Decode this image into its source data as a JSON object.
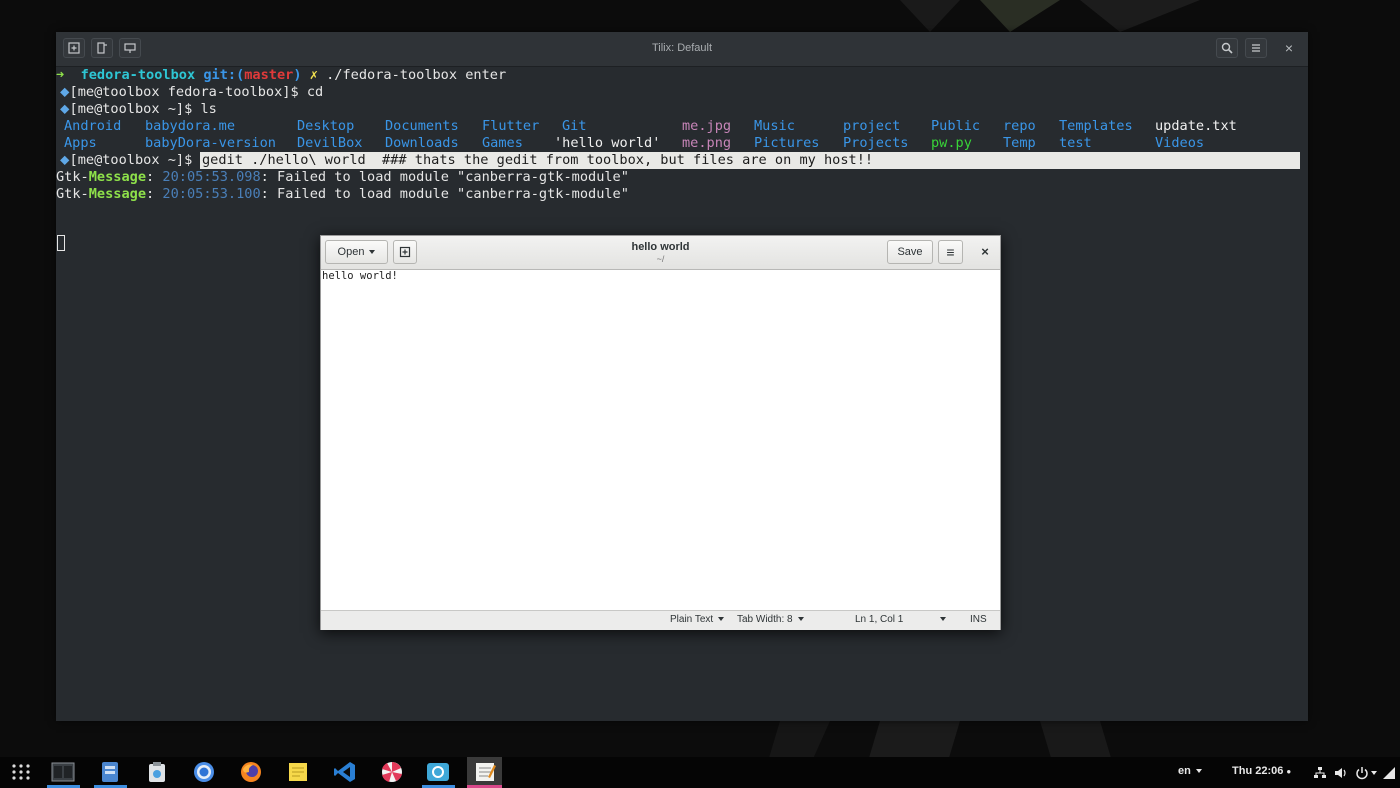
{
  "tilix": {
    "title": "Tilix: Default",
    "buttons": [
      "add-terminal-icon",
      "split-horizontal-icon",
      "split-vertical-icon",
      "search-icon",
      "menu-icon",
      "close-icon"
    ],
    "close_glyph": "×"
  },
  "terminal": {
    "line1": {
      "arrow": "➜",
      "dir": "fedora-toolbox",
      "git_label": "git:(",
      "branch": "master",
      "git_close": ")",
      "dirty": "✗",
      "cmd": "./fedora-toolbox enter"
    },
    "line2": {
      "bullet": "⬥",
      "prompt": "[me@toolbox fedora-toolbox]$",
      "cmd": "cd"
    },
    "line3": {
      "bullet": "⬥",
      "prompt": "[me@toolbox ~]$",
      "cmd": "ls"
    },
    "ls_row1": [
      "Android",
      "babydora.me",
      "Desktop",
      "Documents",
      "Flutter",
      "Git",
      "me.jpg",
      "Music",
      "project",
      "Public",
      "repo",
      "Templates",
      "update.txt"
    ],
    "ls_row2": [
      "Apps",
      "babyDora-version",
      "DevilBox",
      "Downloads",
      "Games",
      "'hello world'",
      "me.png",
      "Pictures",
      "Projects",
      "pw.py",
      "Temp",
      "test",
      "Videos"
    ],
    "line6": {
      "bullet": "⬥",
      "prompt": "[me@toolbox ~]$",
      "cmd": "gedit ./hello\\ world  ### thats the gedit from toolbox, but files are on my host!!"
    },
    "msg1": {
      "prefix": "Gtk-",
      "tag": "Message",
      "colon": ":",
      "time": "20:05:53.098",
      "text": ": Failed to load module \"canberra-gtk-module\""
    },
    "msg2": {
      "prefix": "Gtk-",
      "tag": "Message",
      "colon": ":",
      "time": "20:05:53.100",
      "text": ": Failed to load module \"canberra-gtk-module\""
    }
  },
  "gedit": {
    "open_label": "Open",
    "title": "hello world",
    "subtitle": "~/",
    "save_label": "Save",
    "menu_glyph": "≡",
    "close_glyph": "×",
    "content": "hello world!",
    "status": {
      "language": "Plain Text",
      "tab_width": "Tab Width: 8",
      "position": "Ln 1, Col 1",
      "mode": "INS"
    }
  },
  "taskbar": {
    "apps": [
      "app-grid-icon",
      "tilix-icon",
      "files-icon",
      "clipboard-icon",
      "chromium-icon",
      "firefox-icon",
      "sticky-notes-icon",
      "vscode-icon",
      "peppermint-icon",
      "mojave-icon",
      "gedit-icon"
    ],
    "lang": "en",
    "clock": "Thu 22:06",
    "clock_dot": "●"
  },
  "colors": {
    "terminal_bg": "#272b2f",
    "accent_blue": "#3a96e8",
    "branch_red": "#e03a3a",
    "msg_green": "#8ee04a",
    "underline_blue": "#3d8ee0"
  }
}
